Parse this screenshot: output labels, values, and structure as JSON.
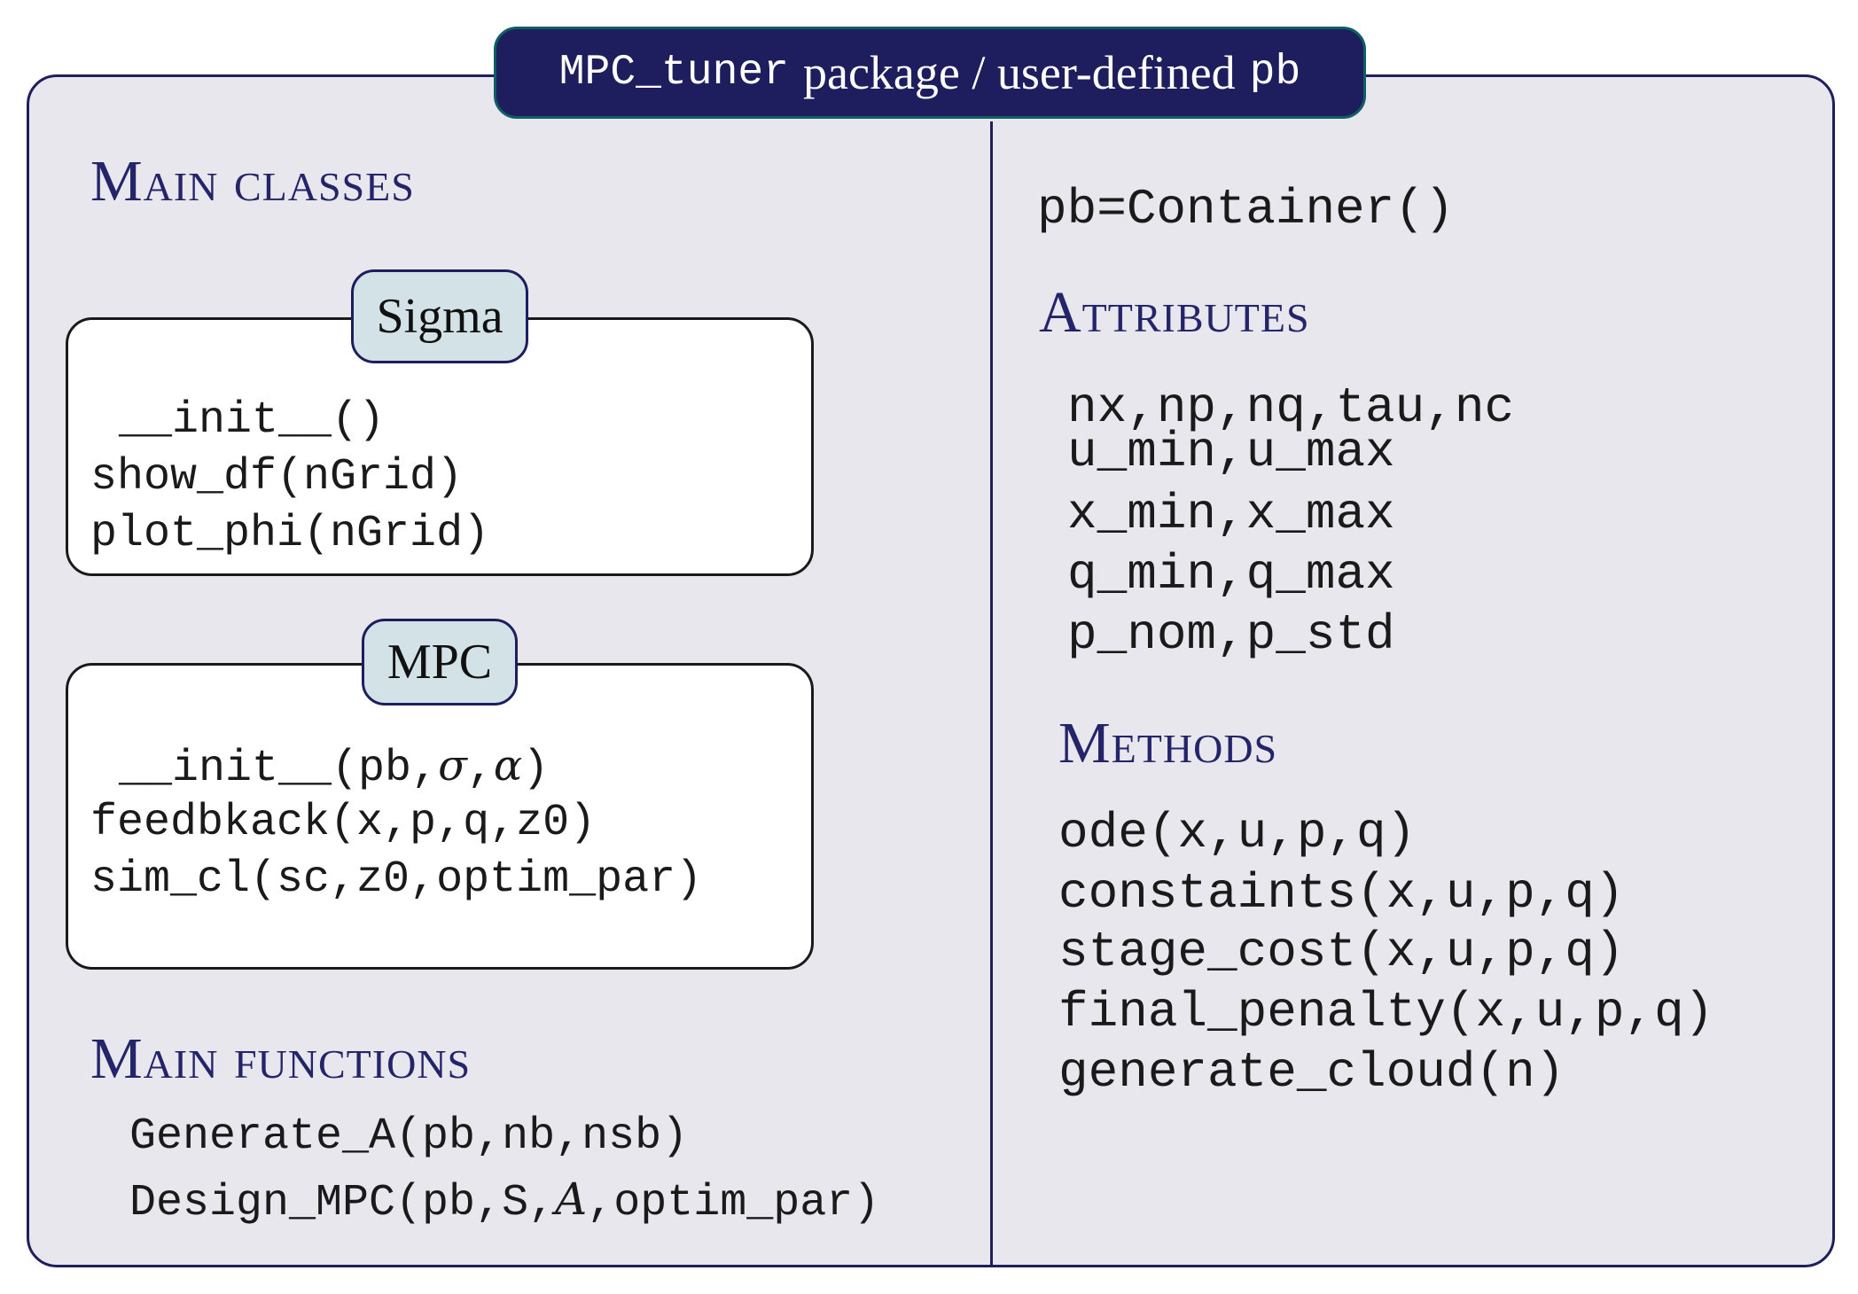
{
  "title": {
    "code_left": "MPC_tuner",
    "text": "package / user-defined",
    "code_right": "pb"
  },
  "left": {
    "main_classes_heading": "Main classes",
    "sigma": {
      "name": "Sigma",
      "methods": [
        "__init__()",
        "show_df(nGrid)",
        "plot_phi(nGrid)"
      ]
    },
    "mpc": {
      "name": "MPC",
      "init_prefix": "__init__(pb,",
      "init_sigma": "σ",
      "init_comma": ",",
      "init_alpha": "α",
      "init_suffix": ")",
      "methods": [
        "feedbkack(x,p,q,z0)",
        "sim_cl(sc,z0,optim_par)"
      ]
    },
    "main_functions_heading": "Main functions",
    "functions": {
      "generate": "Generate_A(pb,nb,nsb)",
      "design_prefix": "Design_MPC(pb,S,",
      "design_script": "A",
      "design_suffix": ",optim_par)"
    }
  },
  "right": {
    "container": "pb=Container()",
    "attributes_heading": "Attributes",
    "attributes": [
      "nx,np,nq,tau,nc",
      "u_min,u_max",
      "x_min,x_max",
      "q_min,q_max",
      "p_nom,p_std"
    ],
    "methods_heading": "Methods",
    "methods": [
      "ode(x,u,p,q)",
      "constaints(x,u,p,q)",
      "stage_cost(x,u,p,q)",
      "final_penalty(x,u,p,q)",
      "generate_cloud(n)"
    ]
  }
}
